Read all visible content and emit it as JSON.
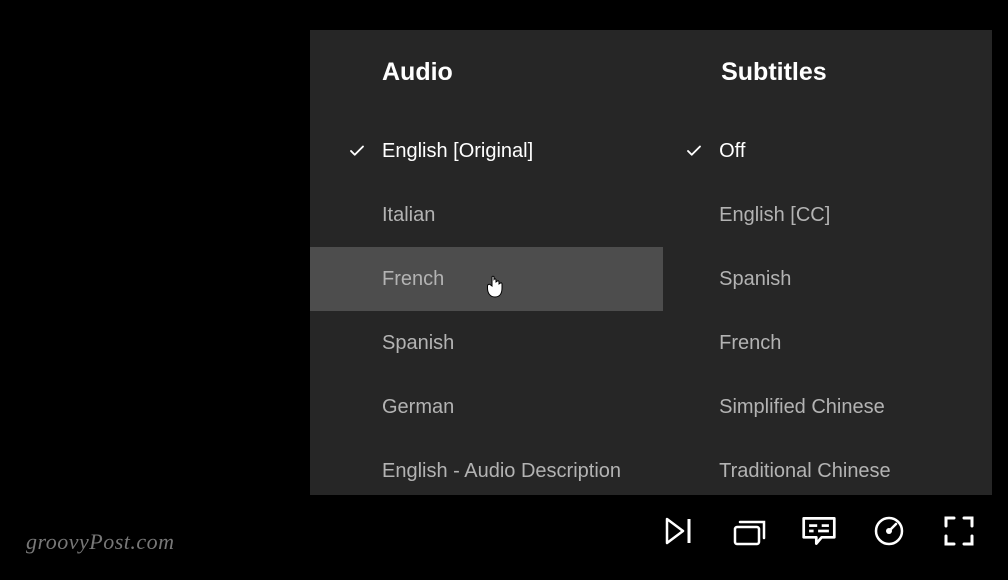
{
  "panel": {
    "audio": {
      "header": "Audio",
      "options": [
        {
          "label": "English [Original]",
          "selected": true,
          "hovered": false
        },
        {
          "label": "Italian",
          "selected": false,
          "hovered": false
        },
        {
          "label": "French",
          "selected": false,
          "hovered": true
        },
        {
          "label": "Spanish",
          "selected": false,
          "hovered": false
        },
        {
          "label": "German",
          "selected": false,
          "hovered": false
        },
        {
          "label": "English - Audio Description",
          "selected": false,
          "hovered": false
        }
      ]
    },
    "subtitles": {
      "header": "Subtitles",
      "options": [
        {
          "label": "Off",
          "selected": true,
          "hovered": false
        },
        {
          "label": "English [CC]",
          "selected": false,
          "hovered": false
        },
        {
          "label": "Spanish",
          "selected": false,
          "hovered": false
        },
        {
          "label": "French",
          "selected": false,
          "hovered": false
        },
        {
          "label": "Simplified Chinese",
          "selected": false,
          "hovered": false
        },
        {
          "label": "Traditional Chinese",
          "selected": false,
          "hovered": false
        }
      ]
    }
  },
  "controls": {
    "next": "next-episode-icon",
    "episodes": "episodes-icon",
    "subtitles": "subtitles-icon",
    "speed": "playback-speed-icon",
    "fullscreen": "fullscreen-icon"
  },
  "watermark": "groovyPost.com"
}
